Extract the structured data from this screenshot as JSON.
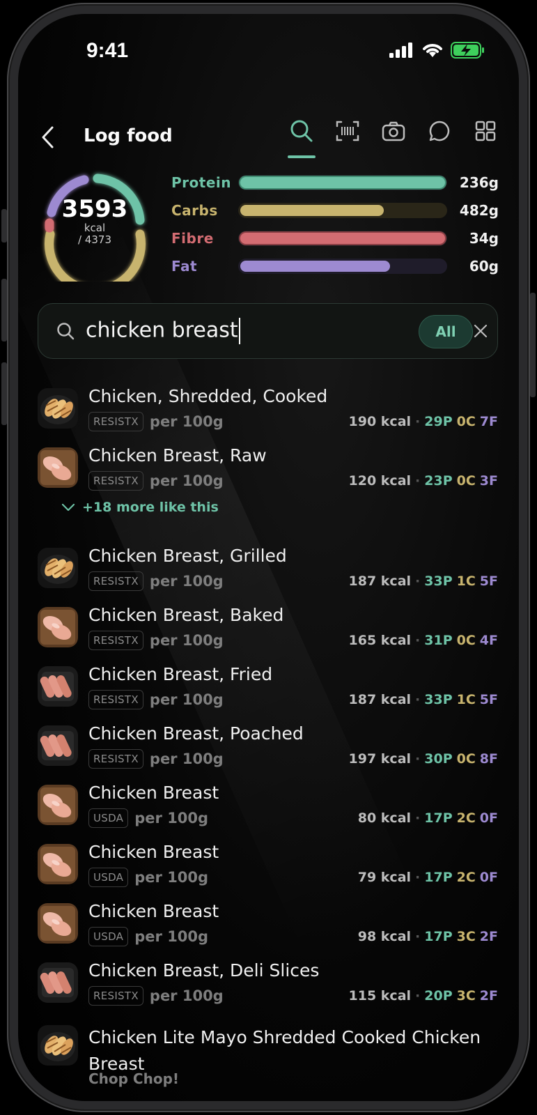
{
  "status_bar": {
    "time": "9:41"
  },
  "header": {
    "title": "Log food"
  },
  "summary": {
    "kcal": "3593",
    "unit": "kcal",
    "goal": "/ 4373",
    "colors": {
      "protein": "#6ec3a7",
      "carbs": "#c8b46e",
      "fibre": "#d36c72",
      "fat": "#9d8ad1"
    }
  },
  "macros": [
    {
      "name": "Protein",
      "value": "236g",
      "progress": 1.0
    },
    {
      "name": "Carbs",
      "value": "482g",
      "progress": 0.7
    },
    {
      "name": "Fibre",
      "value": "34g",
      "progress": 1.0
    },
    {
      "name": "Fat",
      "value": "60g",
      "progress": 0.73
    }
  ],
  "search": {
    "query": "chicken breast",
    "filter": "All"
  },
  "results": [
    {
      "name": "Chicken, Shredded, Cooked",
      "source": "RESISTX",
      "per": "per 100g",
      "kcal": "190 kcal",
      "p": "29P",
      "c": "0C",
      "f": "7F",
      "thumb": "grilled"
    },
    {
      "name": "Chicken Breast, Raw",
      "source": "RESISTX",
      "per": "per 100g",
      "kcal": "120 kcal",
      "p": "23P",
      "c": "0C",
      "f": "3F",
      "thumb": "raw"
    },
    {
      "name": "Chicken Breast, Grilled",
      "source": "RESISTX",
      "per": "per 100g",
      "kcal": "187 kcal",
      "p": "33P",
      "c": "1C",
      "f": "5F",
      "thumb": "grilled"
    },
    {
      "name": "Chicken Breast, Baked",
      "source": "RESISTX",
      "per": "per 100g",
      "kcal": "165 kcal",
      "p": "31P",
      "c": "0C",
      "f": "4F",
      "thumb": "raw"
    },
    {
      "name": "Chicken Breast, Fried",
      "source": "RESISTX",
      "per": "per 100g",
      "kcal": "187 kcal",
      "p": "33P",
      "c": "1C",
      "f": "5F",
      "thumb": "sausage"
    },
    {
      "name": "Chicken Breast, Poached",
      "source": "RESISTX",
      "per": "per 100g",
      "kcal": "197 kcal",
      "p": "30P",
      "c": "0C",
      "f": "8F",
      "thumb": "sausage"
    },
    {
      "name": "Chicken Breast",
      "source": "USDA",
      "per": "per 100g",
      "kcal": "80 kcal",
      "p": "17P",
      "c": "2C",
      "f": "0F",
      "thumb": "raw"
    },
    {
      "name": "Chicken Breast",
      "source": "USDA",
      "per": "per 100g",
      "kcal": "79 kcal",
      "p": "17P",
      "c": "2C",
      "f": "0F",
      "thumb": "raw"
    },
    {
      "name": "Chicken Breast",
      "source": "USDA",
      "per": "per 100g",
      "kcal": "98 kcal",
      "p": "17P",
      "c": "3C",
      "f": "2F",
      "thumb": "raw"
    },
    {
      "name": "Chicken Breast, Deli Slices",
      "source": "RESISTX",
      "per": "per 100g",
      "kcal": "115 kcal",
      "p": "20P",
      "c": "3C",
      "f": "2F",
      "thumb": "sausage"
    }
  ],
  "more_like_this": "+18 more like this",
  "last_result": {
    "name": "Chicken Lite Mayo Shredded Cooked Chicken Breast",
    "brand": "Chop Chop!",
    "thumb": "grilled"
  }
}
